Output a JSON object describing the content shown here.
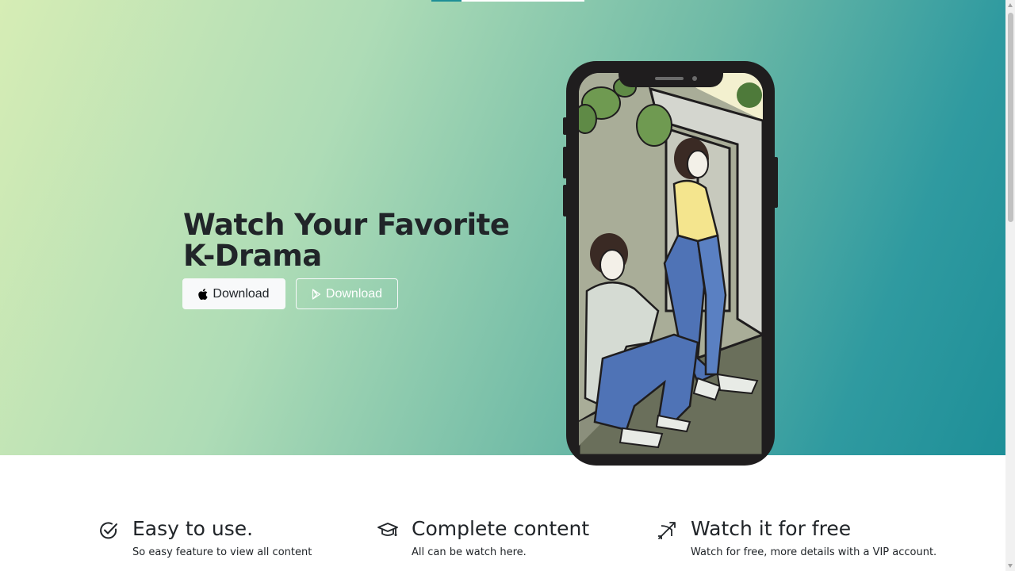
{
  "hero": {
    "title_line1": "Watch Your Favorite",
    "title_line2": "K-Drama",
    "buttons": [
      {
        "label": "Download",
        "icon": "apple-icon"
      },
      {
        "label": "Download",
        "icon": "google-play-icon"
      }
    ]
  },
  "features": [
    {
      "icon": "check-circle-icon",
      "title": "Easy to use.",
      "text": "So easy feature to view all content"
    },
    {
      "icon": "graduation-cap-icon",
      "title": "Complete content",
      "text": "All can be watch here."
    },
    {
      "icon": "bow-and-arrow-icon",
      "title": "Watch it for free",
      "text": "Watch for free, more details with a VIP account."
    }
  ],
  "colors": {
    "gradient_start": "#d6edb5",
    "gradient_end": "#1e8f98",
    "accent": "#1f8f96",
    "button_light": "#f8f9fa"
  }
}
